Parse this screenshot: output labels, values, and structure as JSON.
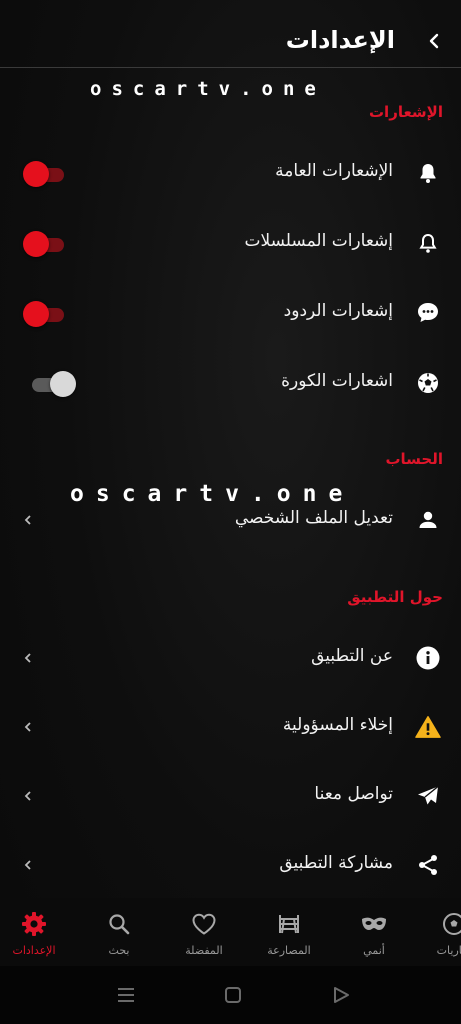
{
  "header": {
    "title": "الإعدادات"
  },
  "watermark": {
    "text": "oscartv.one"
  },
  "sections": {
    "notifications": {
      "title": "الإشعارات",
      "items": [
        {
          "label": "الإشعارات العامة",
          "icon": "bell-icon",
          "enabled": true
        },
        {
          "label": "إشعارات المسلسلات",
          "icon": "bell-outline-icon",
          "enabled": true
        },
        {
          "label": "إشعارات الردود",
          "icon": "chat-bubble-icon",
          "enabled": true
        },
        {
          "label": "اشعارات الكورة",
          "icon": "soccer-ball-icon",
          "enabled": false
        }
      ]
    },
    "account": {
      "title": "الحساب",
      "items": [
        {
          "label": "تعديل الملف الشخصي",
          "icon": "person-icon"
        }
      ]
    },
    "about": {
      "title": "حول التطبيق",
      "items": [
        {
          "label": "عن التطبيق",
          "icon": "info-icon"
        },
        {
          "label": "إخلاء المسؤولية",
          "icon": "warning-icon"
        },
        {
          "label": "تواصل معنا",
          "icon": "send-icon"
        },
        {
          "label": "مشاركة التطبيق",
          "icon": "share-icon"
        }
      ]
    }
  },
  "bottom_nav": [
    {
      "label": "الإعدادات",
      "icon": "gear-icon",
      "active": true
    },
    {
      "label": "بحث",
      "icon": "search-icon",
      "active": false
    },
    {
      "label": "المفضلة",
      "icon": "heart-icon",
      "active": false
    },
    {
      "label": "المصارعة",
      "icon": "wrestling-ring-icon",
      "active": false
    },
    {
      "label": "أنمي",
      "icon": "mask-icon",
      "active": false
    },
    {
      "label": "مباريات",
      "icon": "soccer-ball-icon",
      "active": false
    }
  ],
  "colors": {
    "accent": "#e0152a",
    "background": "#0d0d0d",
    "text": "#f2f2f2"
  }
}
